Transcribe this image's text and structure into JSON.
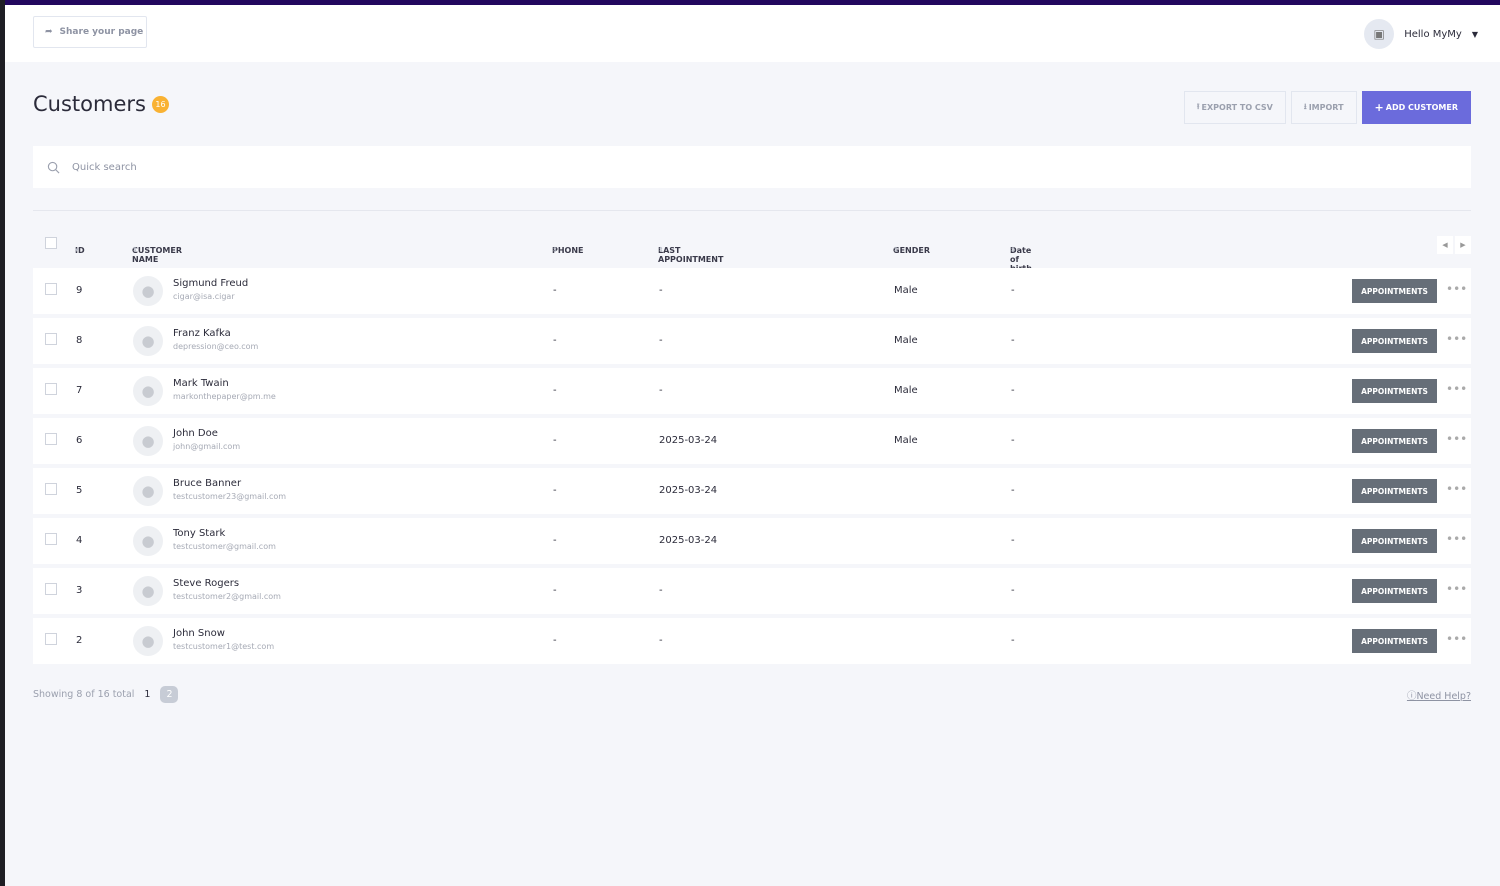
{
  "header": {
    "share_label": "Share your page",
    "user_greeting": "Hello MyMy"
  },
  "page": {
    "title": "Customers",
    "count": "16"
  },
  "actions": {
    "export": "EXPORT TO CSV",
    "import": "IMPORT",
    "add": "ADD CUSTOMER"
  },
  "search": {
    "placeholder": "Quick search"
  },
  "columns": {
    "id": "ID",
    "name": "CUSTOMER NAME",
    "phone": "PHONE",
    "last_appointment": "LAST APPOINTMENT",
    "gender": "GENDER",
    "dob": "Date of birth"
  },
  "row_button": "APPOINTMENTS",
  "customers": [
    {
      "id": "9",
      "name": "Sigmund Freud",
      "email": "cigar@isa.cigar",
      "phone": "-",
      "last": "-",
      "gender": "Male",
      "dob": "-"
    },
    {
      "id": "8",
      "name": "Franz Kafka",
      "email": "depression@ceo.com",
      "phone": "-",
      "last": "-",
      "gender": "Male",
      "dob": "-"
    },
    {
      "id": "7",
      "name": "Mark Twain",
      "email": "markonthepaper@pm.me",
      "phone": "-",
      "last": "-",
      "gender": "Male",
      "dob": "-"
    },
    {
      "id": "6",
      "name": "John Doe",
      "email": "john@gmail.com",
      "phone": "-",
      "last": "2025-03-24",
      "gender": "Male",
      "dob": "-"
    },
    {
      "id": "5",
      "name": "Bruce Banner",
      "email": "testcustomer23@gmail.com",
      "phone": "-",
      "last": "2025-03-24",
      "gender": "",
      "dob": "-"
    },
    {
      "id": "4",
      "name": "Tony Stark",
      "email": "testcustomer@gmail.com",
      "phone": "-",
      "last": "2025-03-24",
      "gender": "",
      "dob": "-"
    },
    {
      "id": "3",
      "name": "Steve Rogers",
      "email": "testcustomer2@gmail.com",
      "phone": "-",
      "last": "-",
      "gender": "",
      "dob": "-"
    },
    {
      "id": "2",
      "name": "John Snow",
      "email": "testcustomer1@test.com",
      "phone": "-",
      "last": "-",
      "gender": "",
      "dob": "-"
    }
  ],
  "footer": {
    "showing": "Showing 8 of 16 total",
    "page1": "1",
    "page2": "2",
    "help": "Need Help?"
  }
}
